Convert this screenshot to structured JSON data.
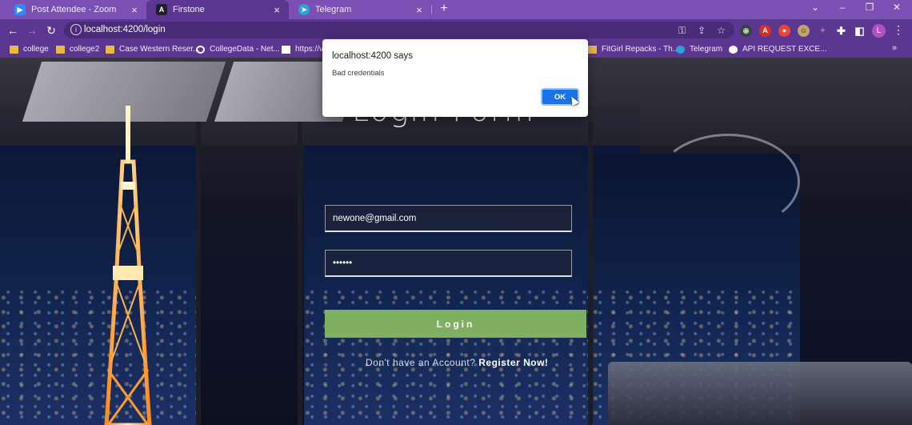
{
  "browser": {
    "tabs": [
      {
        "title": "Post Attendee - Zoom",
        "favicon": "zoom-icon",
        "active": false
      },
      {
        "title": "Firstone",
        "favicon": "angular-icon",
        "active": true
      },
      {
        "title": "Telegram",
        "favicon": "telegram-icon",
        "active": false
      }
    ],
    "new_tab_symbol": "+",
    "url": "localhost:4200/login",
    "bookmarks": [
      {
        "label": "college",
        "icon": "folder-icon"
      },
      {
        "label": "college2",
        "icon": "folder-icon"
      },
      {
        "label": "Case Western Reser...",
        "icon": "folder-icon"
      },
      {
        "label": "CollegeData - Net...",
        "icon": "collegedata-icon"
      },
      {
        "label": "https://v",
        "icon": "site-icon"
      },
      {
        "label": "FitGirl Repacks - Th...",
        "icon": "folder-icon"
      },
      {
        "label": "Telegram",
        "icon": "telegram-icon"
      },
      {
        "label": "API REQUEST EXCE...",
        "icon": "google-icon"
      }
    ],
    "bookmarks_more": "»",
    "profile_initial": "L",
    "ext_a": "A",
    "accent": "#7b4fb3"
  },
  "page": {
    "title": "Login Form",
    "email_value": "newone@gmail.com",
    "password_value": "••••••",
    "login_label": "Login",
    "register_prompt": "Don't have an Account?",
    "register_link": "Register Now!",
    "button_color": "#7fb062"
  },
  "dialog": {
    "origin": "localhost:4200 says",
    "message": "Bad credentials",
    "ok_label": "OK"
  }
}
